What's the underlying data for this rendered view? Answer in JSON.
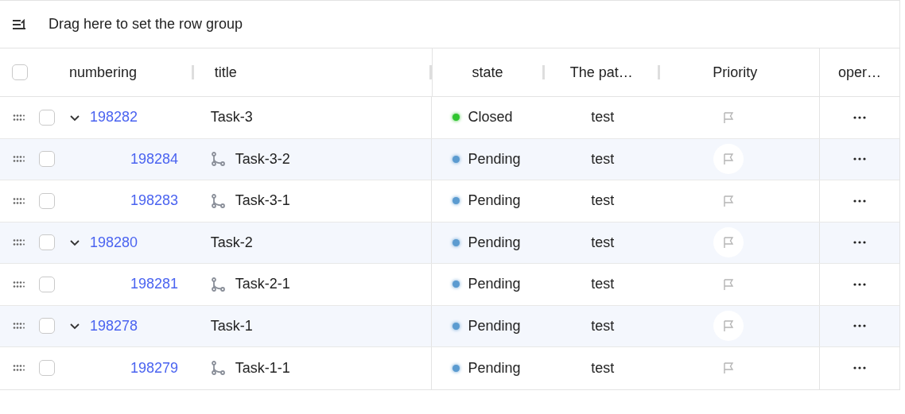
{
  "toolbar": {
    "label": "Drag here to set the row group"
  },
  "table": {
    "select_all": {
      "checked": false
    },
    "columns": [
      "numbering",
      "title",
      "state",
      "The pat…",
      "Priority",
      "oper…"
    ],
    "rows": [
      {
        "numbering": "198282",
        "title": "Task-3",
        "state": {
          "label": "Closed",
          "color": "#2fc52f"
        },
        "path": "test",
        "checked": false,
        "expanded": true,
        "children": [
          {
            "numbering": "198284",
            "title": "Task-3-2",
            "state": {
              "label": "Pending",
              "color": "#5b9bd0"
            },
            "path": "test",
            "checked": false
          },
          {
            "numbering": "198283",
            "title": "Task-3-1",
            "state": {
              "label": "Pending",
              "color": "#5b9bd0"
            },
            "path": "test",
            "checked": false
          }
        ]
      },
      {
        "numbering": "198280",
        "title": "Task-2",
        "state": {
          "label": "Pending",
          "color": "#5b9bd0"
        },
        "path": "test",
        "checked": false,
        "expanded": true,
        "children": [
          {
            "numbering": "198281",
            "title": "Task-2-1",
            "state": {
              "label": "Pending",
              "color": "#5b9bd0"
            },
            "path": "test",
            "checked": false
          }
        ]
      },
      {
        "numbering": "198278",
        "title": "Task-1",
        "state": {
          "label": "Pending",
          "color": "#5b9bd0"
        },
        "path": "test",
        "checked": false,
        "expanded": true,
        "children": [
          {
            "numbering": "198279",
            "title": "Task-1-1",
            "state": {
              "label": "Pending",
              "color": "#5b9bd0"
            },
            "path": "test",
            "checked": false
          }
        ]
      }
    ]
  }
}
